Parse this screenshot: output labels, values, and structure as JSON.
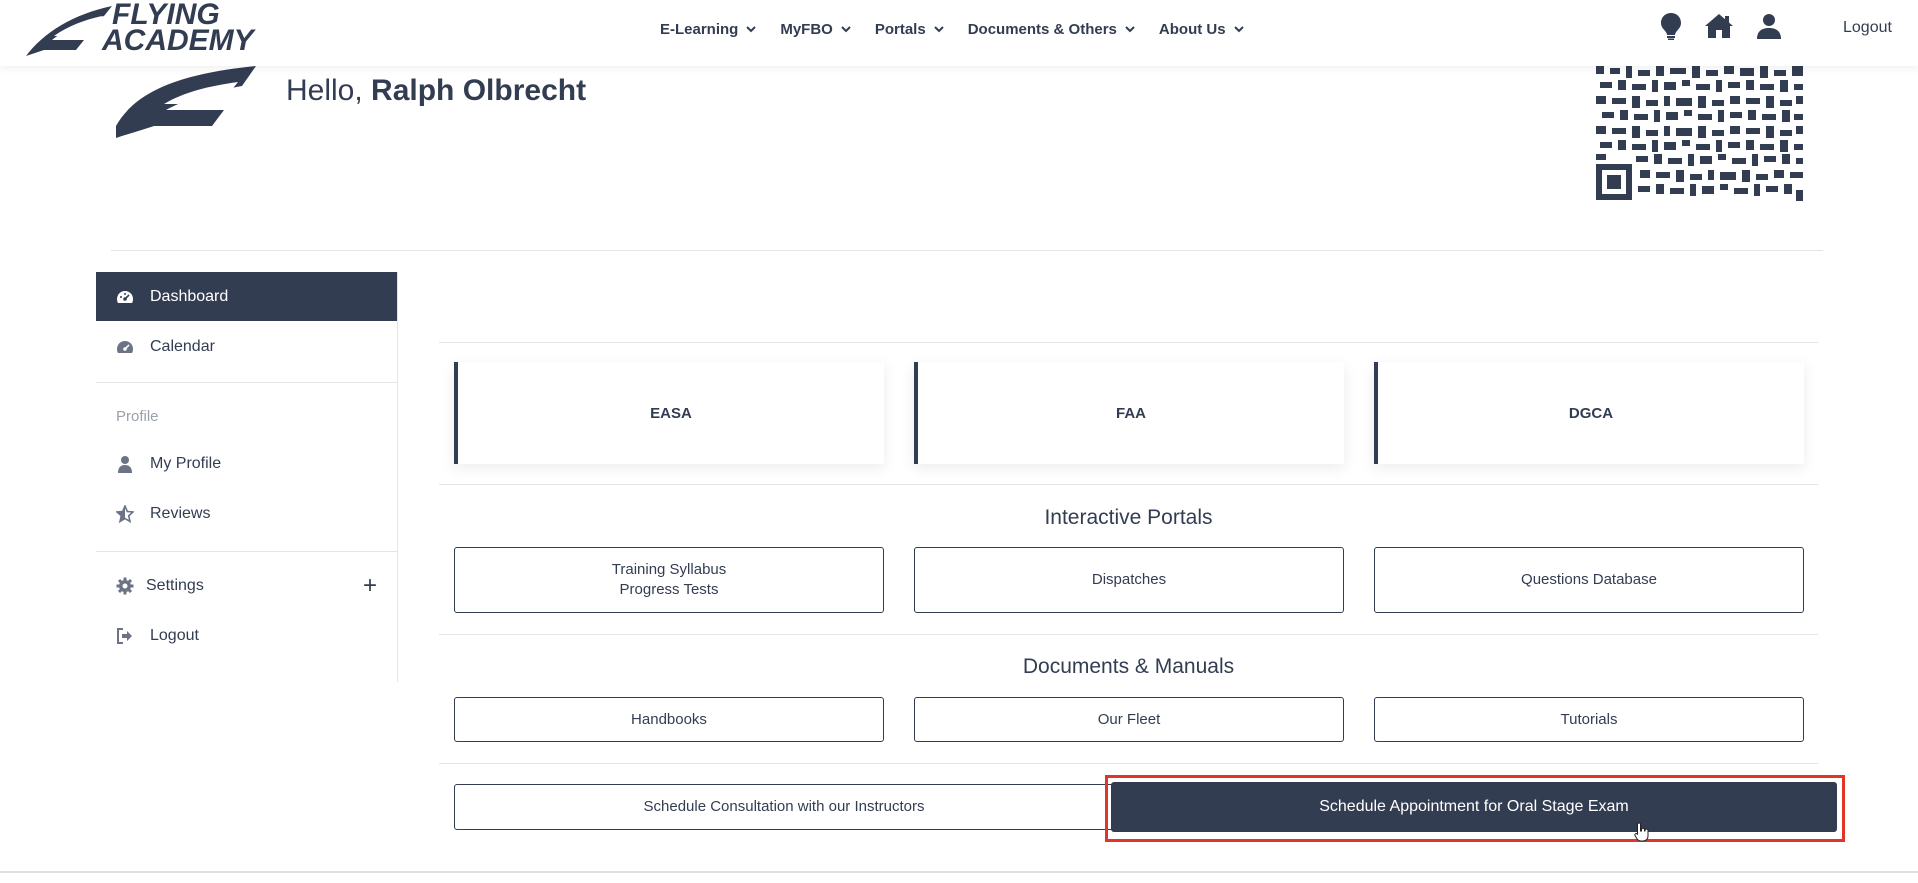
{
  "brand": {
    "line1": "FLYING",
    "line2": "ACADEMY"
  },
  "nav": {
    "items": [
      {
        "label": "E-Learning"
      },
      {
        "label": "MyFBO"
      },
      {
        "label": "Portals"
      },
      {
        "label": "Documents & Others"
      },
      {
        "label": "About Us"
      }
    ],
    "icons": [
      "lightbulb-icon",
      "home-icon",
      "user-icon"
    ],
    "logout": "Logout"
  },
  "header": {
    "greeting": "Hello,",
    "user_name": "Ralph Olbrecht"
  },
  "sidebar": {
    "items": [
      {
        "label": "Dashboard",
        "icon": "dashboard-icon"
      },
      {
        "label": "Calendar",
        "icon": "calendar-icon"
      }
    ],
    "profile_heading": "Profile",
    "profile_items": [
      {
        "label": "My Profile",
        "icon": "user-icon"
      },
      {
        "label": "Reviews",
        "icon": "star-icon"
      }
    ],
    "settings": {
      "label": "Settings",
      "expand": "+"
    },
    "logout": "Logout"
  },
  "main": {
    "cards": [
      "EASA",
      "FAA",
      "DGCA"
    ],
    "interactive_portals": {
      "title": "Interactive Portals",
      "buttons": [
        {
          "line1": "Training Syllabus",
          "line2": "Progress Tests"
        },
        {
          "line1": "Dispatches",
          "line2": ""
        },
        {
          "line1": "Questions Database",
          "line2": ""
        }
      ]
    },
    "documents_manuals": {
      "title": "Documents & Manuals",
      "buttons": [
        "Handbooks",
        "Our Fleet",
        "Tutorials"
      ]
    },
    "schedule_consultation": "Schedule Consultation with our Instructors",
    "schedule_oral_exam": "Schedule Appointment for Oral Stage Exam"
  },
  "colors": {
    "primary": "#333d52",
    "highlight": "#e0362a",
    "muted": "#9aa1ad",
    "divider": "#e3e5e9"
  }
}
